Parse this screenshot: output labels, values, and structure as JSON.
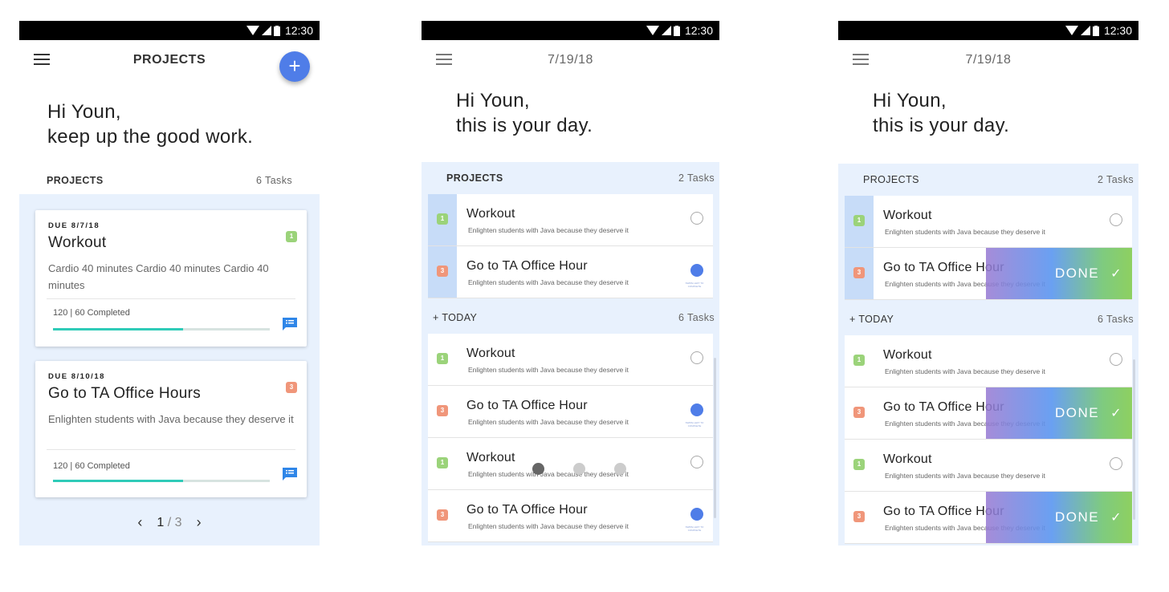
{
  "status": {
    "time": "12:30"
  },
  "screen1": {
    "title": "PROJECTS",
    "fab_label": "+",
    "greeting_line1": "Hi Youn,",
    "greeting_line2": "keep up the good work.",
    "section_title": "PROJECTS",
    "section_count": "6 Tasks",
    "cards": [
      {
        "due": "DUE 8/7/18",
        "title": "Workout",
        "badge": "1",
        "badge_color": "#9bd37a",
        "desc": "Cardio 40 minutes Cardio 40 minutes  Cardio 40 minutes",
        "progress_text": "120 | 60 Completed",
        "progress": 0.6
      },
      {
        "due": "DUE 8/10/18",
        "title": "Go to TA Office Hours",
        "badge": "3",
        "badge_color": "#f0967a",
        "desc": "Enlighten students with Java because they deserve it",
        "progress_text": "120 | 60 Completed",
        "progress": 0.6
      }
    ],
    "pager": {
      "prev": "‹",
      "current": "1",
      "sep": "/",
      "total": "3",
      "next": "›"
    }
  },
  "screen2": {
    "title": "7/19/18",
    "greeting_line1": "Hi Youn,",
    "greeting_line2": "this is your day.",
    "projects_title": "PROJECTS",
    "projects_count": "2 Tasks",
    "today_title": "+ TODAY",
    "today_count": "6 Tasks",
    "projects": [
      {
        "title": "Workout",
        "desc": "Enlighten students with Java because they deserve it",
        "badge": "1",
        "checked": false,
        "hint": ""
      },
      {
        "title": "Go to TA Office Hour",
        "desc": "Enlighten students with Java because they deserve it",
        "badge": "3",
        "checked": true,
        "hint": "SWIPE LEFT TO COMPLETE"
      }
    ],
    "today": [
      {
        "title": "Workout",
        "desc": "Enlighten students with Java because they deserve it",
        "badge": "1",
        "checked": false,
        "hint": ""
      },
      {
        "title": "Go to TA Office Hour",
        "desc": "Enlighten students with Java because they deserve it",
        "badge": "3",
        "checked": true,
        "hint": "SWIPE LEFT TO COMPLETE"
      },
      {
        "title": "Workout",
        "desc": "Enlighten students with Java because they deserve it",
        "badge": "1",
        "checked": false,
        "hint": ""
      },
      {
        "title": "Go to TA Office Hour",
        "desc": "Enlighten students with Java because they deserve it",
        "badge": "3",
        "checked": true,
        "hint": "SWIPE LEFT TO COMPLETE"
      }
    ]
  },
  "screen3": {
    "title": "7/19/18",
    "greeting_line1": "Hi Youn,",
    "greeting_line2": "this is your day.",
    "projects_title": "PROJECTS",
    "projects_count": "2 Tasks",
    "today_title": "+ TODAY",
    "today_count": "6 Tasks",
    "done_label": "DONE",
    "done_check": "✓",
    "projects": [
      {
        "title": "Workout",
        "desc": "Enlighten students with Java because they deserve it",
        "badge": "1"
      },
      {
        "title": "Go to TA Office Hour",
        "desc": "Enlighten students with Java because they deserve it",
        "badge": "3"
      }
    ],
    "today": [
      {
        "title": "Workout",
        "desc": "Enlighten students with Java because they deserve it",
        "badge": "1"
      },
      {
        "title": "Go to TA Office Hour",
        "desc": "Enlighten students with Java because they deserve it",
        "badge": "3"
      },
      {
        "title": "Workout",
        "desc": "Enlighten students with Java because they deserve it",
        "badge": "1"
      },
      {
        "title": "Go to TA Office Hour",
        "desc": "Enlighten students with Java because they deserve it",
        "badge": "3"
      }
    ]
  },
  "colors": {
    "accent": "#4f7de8",
    "list_bg": "#e8f1fd",
    "progress": "#2fcbb8",
    "badge_green": "#9bd37a",
    "badge_orange": "#f0967a"
  }
}
